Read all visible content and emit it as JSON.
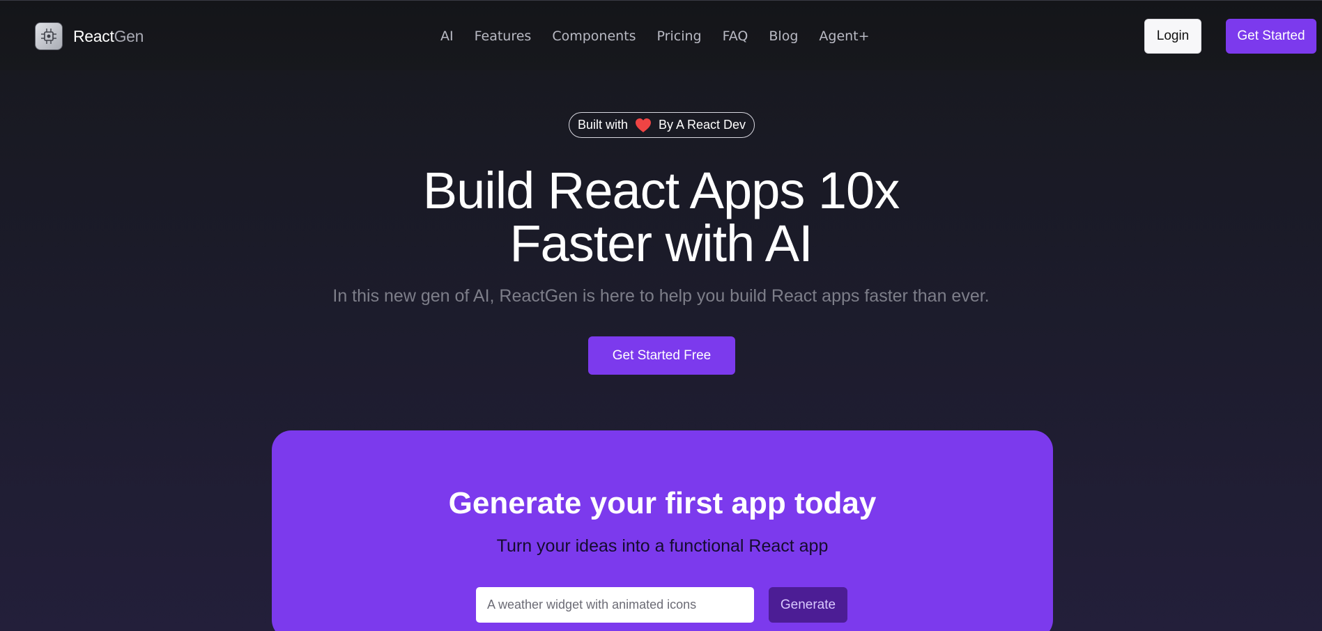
{
  "brand": {
    "name_part1": "React",
    "name_part2": "Gen",
    "accent_color": "#7c3aed",
    "logo_icon": "chip-icon"
  },
  "nav": {
    "links": [
      "AI",
      "Features",
      "Components",
      "Pricing",
      "FAQ",
      "Blog",
      "Agent+"
    ],
    "login_label": "Login",
    "get_started_label": "Get Started"
  },
  "hero": {
    "badge_prefix": "Built with",
    "badge_icon": "heart-icon",
    "badge_suffix": "By A React Dev",
    "title_line1": "Build React Apps 10x",
    "title_line2": "Faster with AI",
    "subtitle": "In this new gen of AI, ReactGen is here to help you build React apps faster than ever.",
    "cta_label": "Get Started Free"
  },
  "generator": {
    "title": "Generate your first app today",
    "subtitle": "Turn your ideas into a functional React app",
    "input_placeholder": "A weather widget with animated icons",
    "input_value": "",
    "button_label": "Generate"
  }
}
